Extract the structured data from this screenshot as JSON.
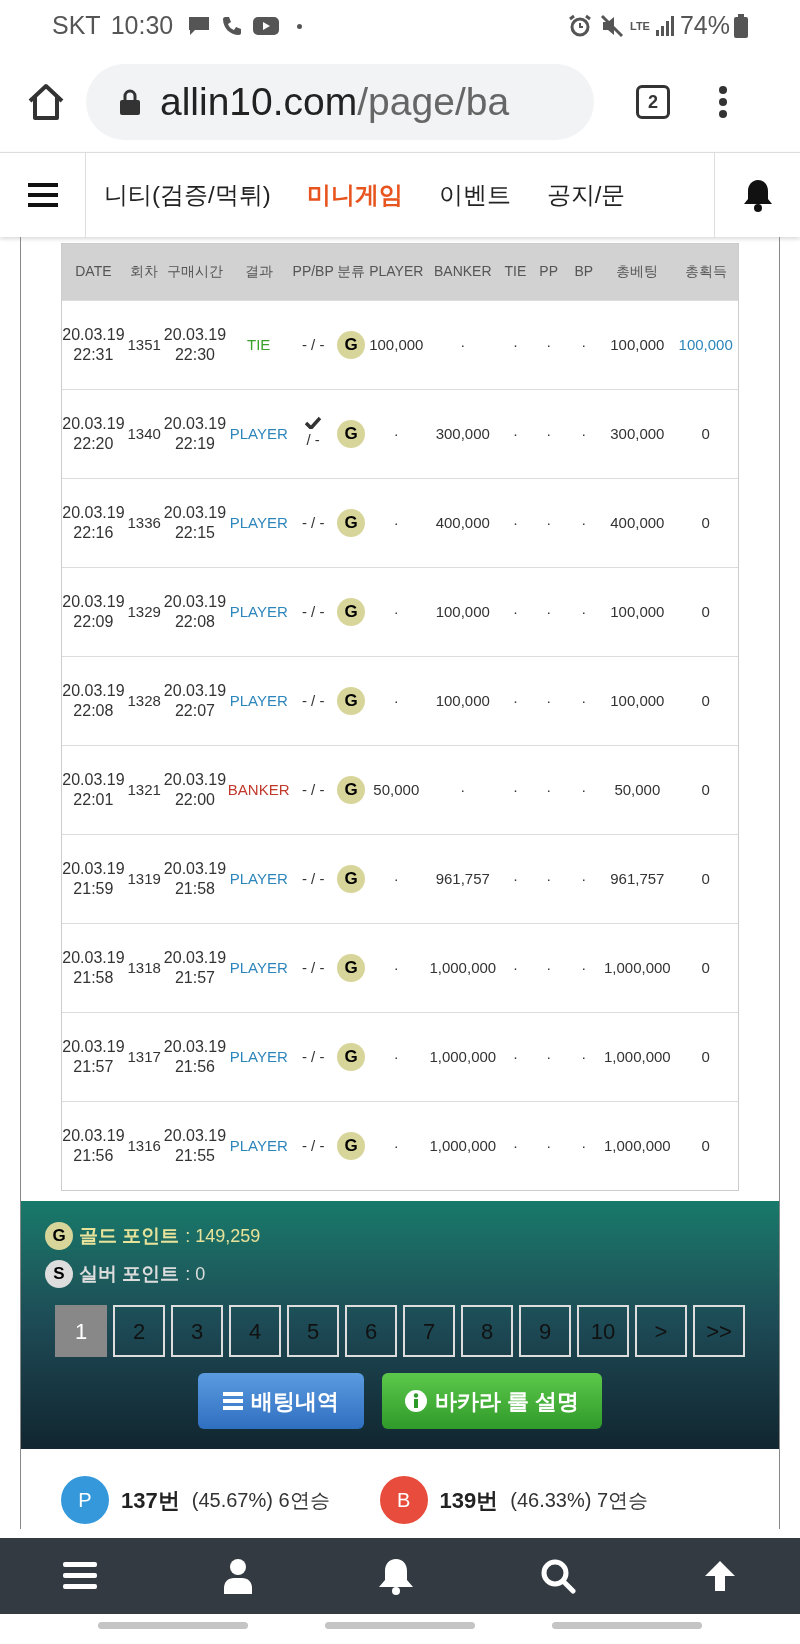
{
  "status_bar": {
    "carrier": "SKT",
    "time": "10:30",
    "network": "LTE",
    "battery": "74%"
  },
  "browser": {
    "domain": "allin10.com",
    "path": "/page/ba",
    "tab_count": "2"
  },
  "nav": {
    "items": [
      {
        "label": "니티(검증/먹튀)",
        "selected": false
      },
      {
        "label": "미니게임",
        "selected": true
      },
      {
        "label": "이벤트",
        "selected": false
      },
      {
        "label": "공지/문",
        "selected": false
      }
    ]
  },
  "table": {
    "columns": [
      "DATE",
      "회차",
      "구매시간",
      "결과",
      "PP/BP",
      "분류",
      "PLAYER",
      "BANKER",
      "TIE",
      "PP",
      "BP",
      "총베팅",
      "총획득"
    ],
    "rows": [
      {
        "date": "20.03.19",
        "date_time": "22:31",
        "round": "1351",
        "buy_date": "20.03.19",
        "buy_time": "22:30",
        "result": {
          "text": "TIE",
          "kind": "tie"
        },
        "pp_checked": false,
        "pp_bp": "- / -",
        "category": "G",
        "player": "100,000",
        "banker": "·",
        "tie": "·",
        "pp": "·",
        "bp": "·",
        "total_bet": "100,000",
        "total_won": "100,000",
        "won": true
      },
      {
        "date": "20.03.19",
        "date_time": "22:20",
        "round": "1340",
        "buy_date": "20.03.19",
        "buy_time": "22:19",
        "result": {
          "text": "PLAYER",
          "kind": "player"
        },
        "pp_checked": true,
        "pp_bp": "/ -",
        "category": "G",
        "player": "·",
        "banker": "300,000",
        "tie": "·",
        "pp": "·",
        "bp": "·",
        "total_bet": "300,000",
        "total_won": "0",
        "won": false
      },
      {
        "date": "20.03.19",
        "date_time": "22:16",
        "round": "1336",
        "buy_date": "20.03.19",
        "buy_time": "22:15",
        "result": {
          "text": "PLAYER",
          "kind": "player"
        },
        "pp_checked": false,
        "pp_bp": "- / -",
        "category": "G",
        "player": "·",
        "banker": "400,000",
        "tie": "·",
        "pp": "·",
        "bp": "·",
        "total_bet": "400,000",
        "total_won": "0",
        "won": false
      },
      {
        "date": "20.03.19",
        "date_time": "22:09",
        "round": "1329",
        "buy_date": "20.03.19",
        "buy_time": "22:08",
        "result": {
          "text": "PLAYER",
          "kind": "player"
        },
        "pp_checked": false,
        "pp_bp": "- / -",
        "category": "G",
        "player": "·",
        "banker": "100,000",
        "tie": "·",
        "pp": "·",
        "bp": "·",
        "total_bet": "100,000",
        "total_won": "0",
        "won": false
      },
      {
        "date": "20.03.19",
        "date_time": "22:08",
        "round": "1328",
        "buy_date": "20.03.19",
        "buy_time": "22:07",
        "result": {
          "text": "PLAYER",
          "kind": "player"
        },
        "pp_checked": false,
        "pp_bp": "- / -",
        "category": "G",
        "player": "·",
        "banker": "100,000",
        "tie": "·",
        "pp": "·",
        "bp": "·",
        "total_bet": "100,000",
        "total_won": "0",
        "won": false
      },
      {
        "date": "20.03.19",
        "date_time": "22:01",
        "round": "1321",
        "buy_date": "20.03.19",
        "buy_time": "22:00",
        "result": {
          "text": "BANKER",
          "kind": "banker"
        },
        "pp_checked": false,
        "pp_bp": "- / -",
        "category": "G",
        "player": "50,000",
        "banker": "·",
        "tie": "·",
        "pp": "·",
        "bp": "·",
        "total_bet": "50,000",
        "total_won": "0",
        "won": false
      },
      {
        "date": "20.03.19",
        "date_time": "21:59",
        "round": "1319",
        "buy_date": "20.03.19",
        "buy_time": "21:58",
        "result": {
          "text": "PLAYER",
          "kind": "player"
        },
        "pp_checked": false,
        "pp_bp": "- / -",
        "category": "G",
        "player": "·",
        "banker": "961,757",
        "tie": "·",
        "pp": "·",
        "bp": "·",
        "total_bet": "961,757",
        "total_won": "0",
        "won": false
      },
      {
        "date": "20.03.19",
        "date_time": "21:58",
        "round": "1318",
        "buy_date": "20.03.19",
        "buy_time": "21:57",
        "result": {
          "text": "PLAYER",
          "kind": "player"
        },
        "pp_checked": false,
        "pp_bp": "- / -",
        "category": "G",
        "player": "·",
        "banker": "1,000,000",
        "tie": "·",
        "pp": "·",
        "bp": "·",
        "total_bet": "1,000,000",
        "total_won": "0",
        "won": false
      },
      {
        "date": "20.03.19",
        "date_time": "21:57",
        "round": "1317",
        "buy_date": "20.03.19",
        "buy_time": "21:56",
        "result": {
          "text": "PLAYER",
          "kind": "player"
        },
        "pp_checked": false,
        "pp_bp": "- / -",
        "category": "G",
        "player": "·",
        "banker": "1,000,000",
        "tie": "·",
        "pp": "·",
        "bp": "·",
        "total_bet": "1,000,000",
        "total_won": "0",
        "won": false
      },
      {
        "date": "20.03.19",
        "date_time": "21:56",
        "round": "1316",
        "buy_date": "20.03.19",
        "buy_time": "21:55",
        "result": {
          "text": "PLAYER",
          "kind": "player"
        },
        "pp_checked": false,
        "pp_bp": "- / -",
        "category": "G",
        "player": "·",
        "banker": "1,000,000",
        "tie": "·",
        "pp": "·",
        "bp": "·",
        "total_bet": "1,000,000",
        "total_won": "0",
        "won": false
      }
    ]
  },
  "points": [
    {
      "badge": "G",
      "label": "골드 포인트",
      "value": ": 149,259",
      "kind": "gold"
    },
    {
      "badge": "S",
      "label": "실버 포인트",
      "value": ": 0",
      "kind": "silver"
    }
  ],
  "pagination": [
    {
      "label": "1",
      "selected": true
    },
    {
      "label": "2",
      "selected": false
    },
    {
      "label": "3",
      "selected": false
    },
    {
      "label": "4",
      "selected": false
    },
    {
      "label": "5",
      "selected": false
    },
    {
      "label": "6",
      "selected": false
    },
    {
      "label": "7",
      "selected": false
    },
    {
      "label": "8",
      "selected": false
    },
    {
      "label": "9",
      "selected": false
    },
    {
      "label": "10",
      "selected": false
    },
    {
      "label": ">",
      "selected": false
    },
    {
      "label": ">>",
      "selected": false
    }
  ],
  "buttons": [
    {
      "label": "배팅내역",
      "kind": "history"
    },
    {
      "label": "바카라 룰 설명",
      "kind": "rules"
    }
  ],
  "stats": [
    {
      "badge": "P",
      "color": "#3498db",
      "count": "137번",
      "detail": "(45.67%) 6연승"
    },
    {
      "badge": "B",
      "color": "#e74c3c",
      "count": "139번",
      "detail": "(46.33%) 7연승"
    }
  ]
}
